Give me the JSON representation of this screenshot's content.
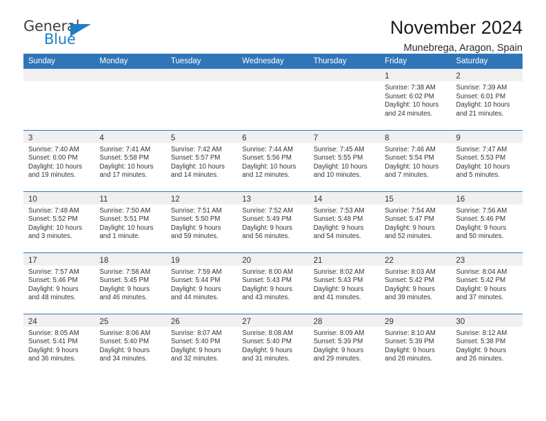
{
  "brand": {
    "name_top": "General",
    "name_bottom": "Blue",
    "triangle_icon": "triangle-icon",
    "color_blue": "#1b7fc4",
    "color_dark": "#3f3f3f"
  },
  "header": {
    "title": "November 2024",
    "subtitle": "Munebrega, Aragon, Spain"
  },
  "theme": {
    "header_blue": "#3075b8",
    "daynum_band": "#f0f0f0",
    "text": "#333333"
  },
  "weekday_headers": [
    "Sunday",
    "Monday",
    "Tuesday",
    "Wednesday",
    "Thursday",
    "Friday",
    "Saturday"
  ],
  "weeks": [
    [
      {
        "empty": true
      },
      {
        "empty": true
      },
      {
        "empty": true
      },
      {
        "empty": true
      },
      {
        "empty": true
      },
      {
        "day": "1",
        "sunrise": "Sunrise: 7:38 AM",
        "sunset": "Sunset: 6:02 PM",
        "daylight1": "Daylight: 10 hours",
        "daylight2": "and 24 minutes."
      },
      {
        "day": "2",
        "sunrise": "Sunrise: 7:39 AM",
        "sunset": "Sunset: 6:01 PM",
        "daylight1": "Daylight: 10 hours",
        "daylight2": "and 21 minutes."
      }
    ],
    [
      {
        "day": "3",
        "sunrise": "Sunrise: 7:40 AM",
        "sunset": "Sunset: 6:00 PM",
        "daylight1": "Daylight: 10 hours",
        "daylight2": "and 19 minutes."
      },
      {
        "day": "4",
        "sunrise": "Sunrise: 7:41 AM",
        "sunset": "Sunset: 5:58 PM",
        "daylight1": "Daylight: 10 hours",
        "daylight2": "and 17 minutes."
      },
      {
        "day": "5",
        "sunrise": "Sunrise: 7:42 AM",
        "sunset": "Sunset: 5:57 PM",
        "daylight1": "Daylight: 10 hours",
        "daylight2": "and 14 minutes."
      },
      {
        "day": "6",
        "sunrise": "Sunrise: 7:44 AM",
        "sunset": "Sunset: 5:56 PM",
        "daylight1": "Daylight: 10 hours",
        "daylight2": "and 12 minutes."
      },
      {
        "day": "7",
        "sunrise": "Sunrise: 7:45 AM",
        "sunset": "Sunset: 5:55 PM",
        "daylight1": "Daylight: 10 hours",
        "daylight2": "and 10 minutes."
      },
      {
        "day": "8",
        "sunrise": "Sunrise: 7:46 AM",
        "sunset": "Sunset: 5:54 PM",
        "daylight1": "Daylight: 10 hours",
        "daylight2": "and 7 minutes."
      },
      {
        "day": "9",
        "sunrise": "Sunrise: 7:47 AM",
        "sunset": "Sunset: 5:53 PM",
        "daylight1": "Daylight: 10 hours",
        "daylight2": "and 5 minutes."
      }
    ],
    [
      {
        "day": "10",
        "sunrise": "Sunrise: 7:48 AM",
        "sunset": "Sunset: 5:52 PM",
        "daylight1": "Daylight: 10 hours",
        "daylight2": "and 3 minutes."
      },
      {
        "day": "11",
        "sunrise": "Sunrise: 7:50 AM",
        "sunset": "Sunset: 5:51 PM",
        "daylight1": "Daylight: 10 hours",
        "daylight2": "and 1 minute."
      },
      {
        "day": "12",
        "sunrise": "Sunrise: 7:51 AM",
        "sunset": "Sunset: 5:50 PM",
        "daylight1": "Daylight: 9 hours",
        "daylight2": "and 59 minutes."
      },
      {
        "day": "13",
        "sunrise": "Sunrise: 7:52 AM",
        "sunset": "Sunset: 5:49 PM",
        "daylight1": "Daylight: 9 hours",
        "daylight2": "and 56 minutes."
      },
      {
        "day": "14",
        "sunrise": "Sunrise: 7:53 AM",
        "sunset": "Sunset: 5:48 PM",
        "daylight1": "Daylight: 9 hours",
        "daylight2": "and 54 minutes."
      },
      {
        "day": "15",
        "sunrise": "Sunrise: 7:54 AM",
        "sunset": "Sunset: 5:47 PM",
        "daylight1": "Daylight: 9 hours",
        "daylight2": "and 52 minutes."
      },
      {
        "day": "16",
        "sunrise": "Sunrise: 7:56 AM",
        "sunset": "Sunset: 5:46 PM",
        "daylight1": "Daylight: 9 hours",
        "daylight2": "and 50 minutes."
      }
    ],
    [
      {
        "day": "17",
        "sunrise": "Sunrise: 7:57 AM",
        "sunset": "Sunset: 5:46 PM",
        "daylight1": "Daylight: 9 hours",
        "daylight2": "and 48 minutes."
      },
      {
        "day": "18",
        "sunrise": "Sunrise: 7:58 AM",
        "sunset": "Sunset: 5:45 PM",
        "daylight1": "Daylight: 9 hours",
        "daylight2": "and 46 minutes."
      },
      {
        "day": "19",
        "sunrise": "Sunrise: 7:59 AM",
        "sunset": "Sunset: 5:44 PM",
        "daylight1": "Daylight: 9 hours",
        "daylight2": "and 44 minutes."
      },
      {
        "day": "20",
        "sunrise": "Sunrise: 8:00 AM",
        "sunset": "Sunset: 5:43 PM",
        "daylight1": "Daylight: 9 hours",
        "daylight2": "and 43 minutes."
      },
      {
        "day": "21",
        "sunrise": "Sunrise: 8:02 AM",
        "sunset": "Sunset: 5:43 PM",
        "daylight1": "Daylight: 9 hours",
        "daylight2": "and 41 minutes."
      },
      {
        "day": "22",
        "sunrise": "Sunrise: 8:03 AM",
        "sunset": "Sunset: 5:42 PM",
        "daylight1": "Daylight: 9 hours",
        "daylight2": "and 39 minutes."
      },
      {
        "day": "23",
        "sunrise": "Sunrise: 8:04 AM",
        "sunset": "Sunset: 5:42 PM",
        "daylight1": "Daylight: 9 hours",
        "daylight2": "and 37 minutes."
      }
    ],
    [
      {
        "day": "24",
        "sunrise": "Sunrise: 8:05 AM",
        "sunset": "Sunset: 5:41 PM",
        "daylight1": "Daylight: 9 hours",
        "daylight2": "and 36 minutes."
      },
      {
        "day": "25",
        "sunrise": "Sunrise: 8:06 AM",
        "sunset": "Sunset: 5:40 PM",
        "daylight1": "Daylight: 9 hours",
        "daylight2": "and 34 minutes."
      },
      {
        "day": "26",
        "sunrise": "Sunrise: 8:07 AM",
        "sunset": "Sunset: 5:40 PM",
        "daylight1": "Daylight: 9 hours",
        "daylight2": "and 32 minutes."
      },
      {
        "day": "27",
        "sunrise": "Sunrise: 8:08 AM",
        "sunset": "Sunset: 5:40 PM",
        "daylight1": "Daylight: 9 hours",
        "daylight2": "and 31 minutes."
      },
      {
        "day": "28",
        "sunrise": "Sunrise: 8:09 AM",
        "sunset": "Sunset: 5:39 PM",
        "daylight1": "Daylight: 9 hours",
        "daylight2": "and 29 minutes."
      },
      {
        "day": "29",
        "sunrise": "Sunrise: 8:10 AM",
        "sunset": "Sunset: 5:39 PM",
        "daylight1": "Daylight: 9 hours",
        "daylight2": "and 28 minutes."
      },
      {
        "day": "30",
        "sunrise": "Sunrise: 8:12 AM",
        "sunset": "Sunset: 5:38 PM",
        "daylight1": "Daylight: 9 hours",
        "daylight2": "and 26 minutes."
      }
    ]
  ]
}
